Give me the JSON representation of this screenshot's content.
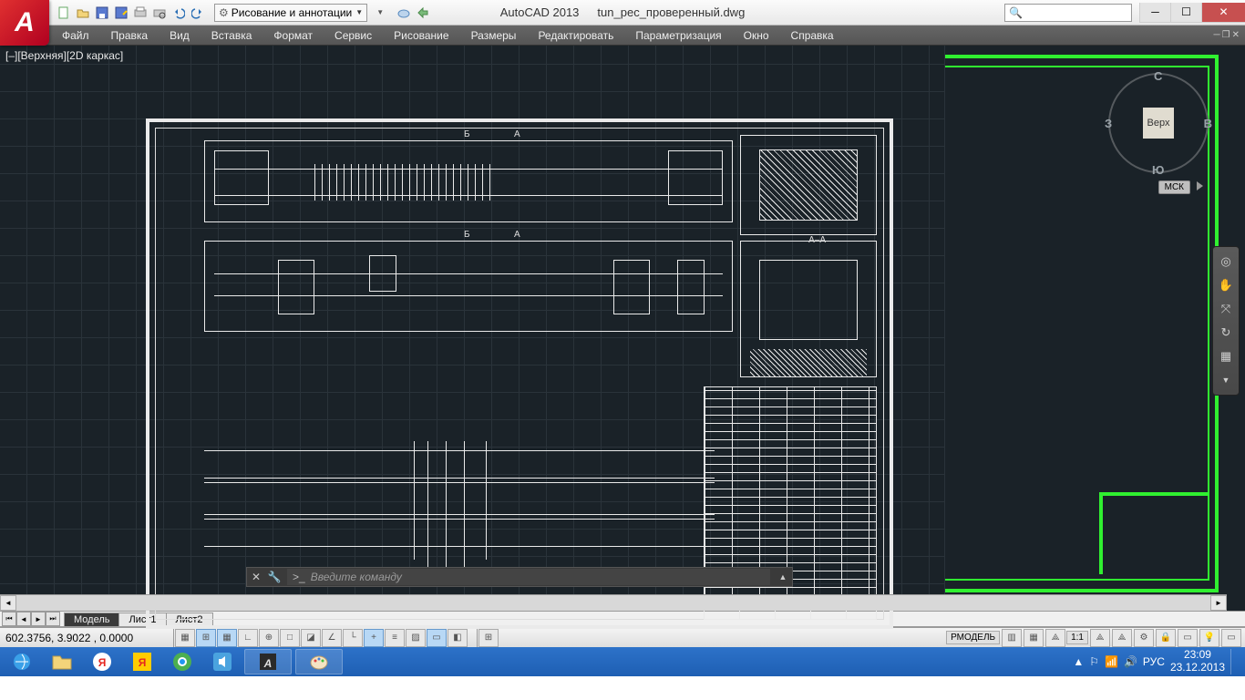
{
  "app": {
    "name": "AutoCAD 2013",
    "file": "tun_pec_проверенный.dwg"
  },
  "qat_icons": [
    "new",
    "open",
    "save",
    "saveas",
    "plot",
    "undo",
    "redo",
    "workspace"
  ],
  "workspace": {
    "label": "Рисование и аннотации"
  },
  "menu": [
    "Файл",
    "Правка",
    "Вид",
    "Вставка",
    "Формат",
    "Сервис",
    "Рисование",
    "Размеры",
    "Редактировать",
    "Параметризация",
    "Окно",
    "Справка"
  ],
  "view_label": "[–][Верхняя][2D каркас]",
  "viewcube": {
    "top": "Верх",
    "n": "С",
    "s": "Ю",
    "e": "В",
    "w": "З",
    "ucs": "МСК"
  },
  "drawing_labels": {
    "b1": "Б",
    "b2": "Б",
    "a1": "А",
    "a2": "А",
    "aa": "А–А"
  },
  "cmdline": {
    "prompt": ">_",
    "placeholder": "Введите команду"
  },
  "tabs": {
    "model": "Модель",
    "sheets": [
      "Лист1",
      "Лист2"
    ]
  },
  "status": {
    "coords": "602.3756, 3.9022 , 0.0000",
    "model_btn": "РМОДЕЛЬ",
    "scale": "1:1"
  },
  "taskbar": {
    "items": [
      "ie",
      "explorer",
      "yandex",
      "ya",
      "chrome",
      "sound",
      "autocad",
      "paint"
    ],
    "tray": {
      "lang": "РУС",
      "time": "23:09",
      "date": "23.12.2013"
    }
  }
}
